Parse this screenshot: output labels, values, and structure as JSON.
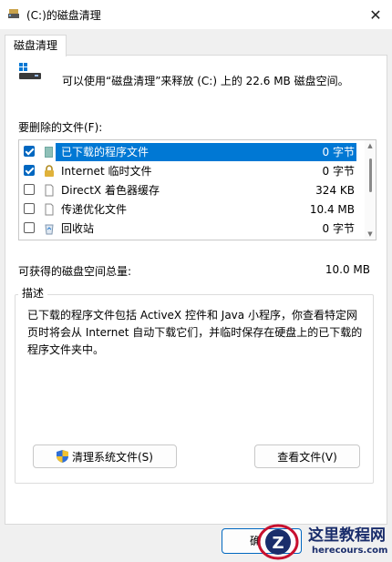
{
  "window": {
    "title": "(C:)的磁盘清理",
    "close_glyph": "✕"
  },
  "tab": {
    "label": "磁盘清理"
  },
  "summary_text": "可以使用“磁盘清理”来释放  (C:) 上的 22.6 MB 磁盘空间。",
  "files_label": "要删除的文件(F):",
  "files": [
    {
      "name": "已下载的程序文件",
      "size": "0 字节",
      "checked": true,
      "selected": true,
      "icon": "folder-icon"
    },
    {
      "name": "Internet 临时文件",
      "size": "0 字节",
      "checked": true,
      "selected": false,
      "icon": "lock-icon"
    },
    {
      "name": "DirectX 着色器缓存",
      "size": "324 KB",
      "checked": false,
      "selected": false,
      "icon": "file-icon"
    },
    {
      "name": "传递优化文件",
      "size": "10.4 MB",
      "checked": false,
      "selected": false,
      "icon": "file-icon"
    },
    {
      "name": "回收站",
      "size": "0 字节",
      "checked": false,
      "selected": false,
      "icon": "recycle-bin-icon"
    }
  ],
  "total": {
    "label": "可获得的磁盘空间总量:",
    "value": "10.0 MB"
  },
  "description": {
    "legend": "描述",
    "text": "已下载的程序文件包括 ActiveX 控件和 Java 小程序，你查看特定网页时将会从 Internet 自动下载它们，并临时保存在硬盘上的已下载的程序文件夹中。"
  },
  "buttons": {
    "clean_system": "清理系统文件(S)",
    "view_files": "查看文件(V)",
    "ok": "确"
  },
  "watermark": {
    "title": "这里教程网",
    "url": "herecours.com"
  },
  "colors": {
    "accent": "#0078d4",
    "brand": "#1a2d6b"
  }
}
